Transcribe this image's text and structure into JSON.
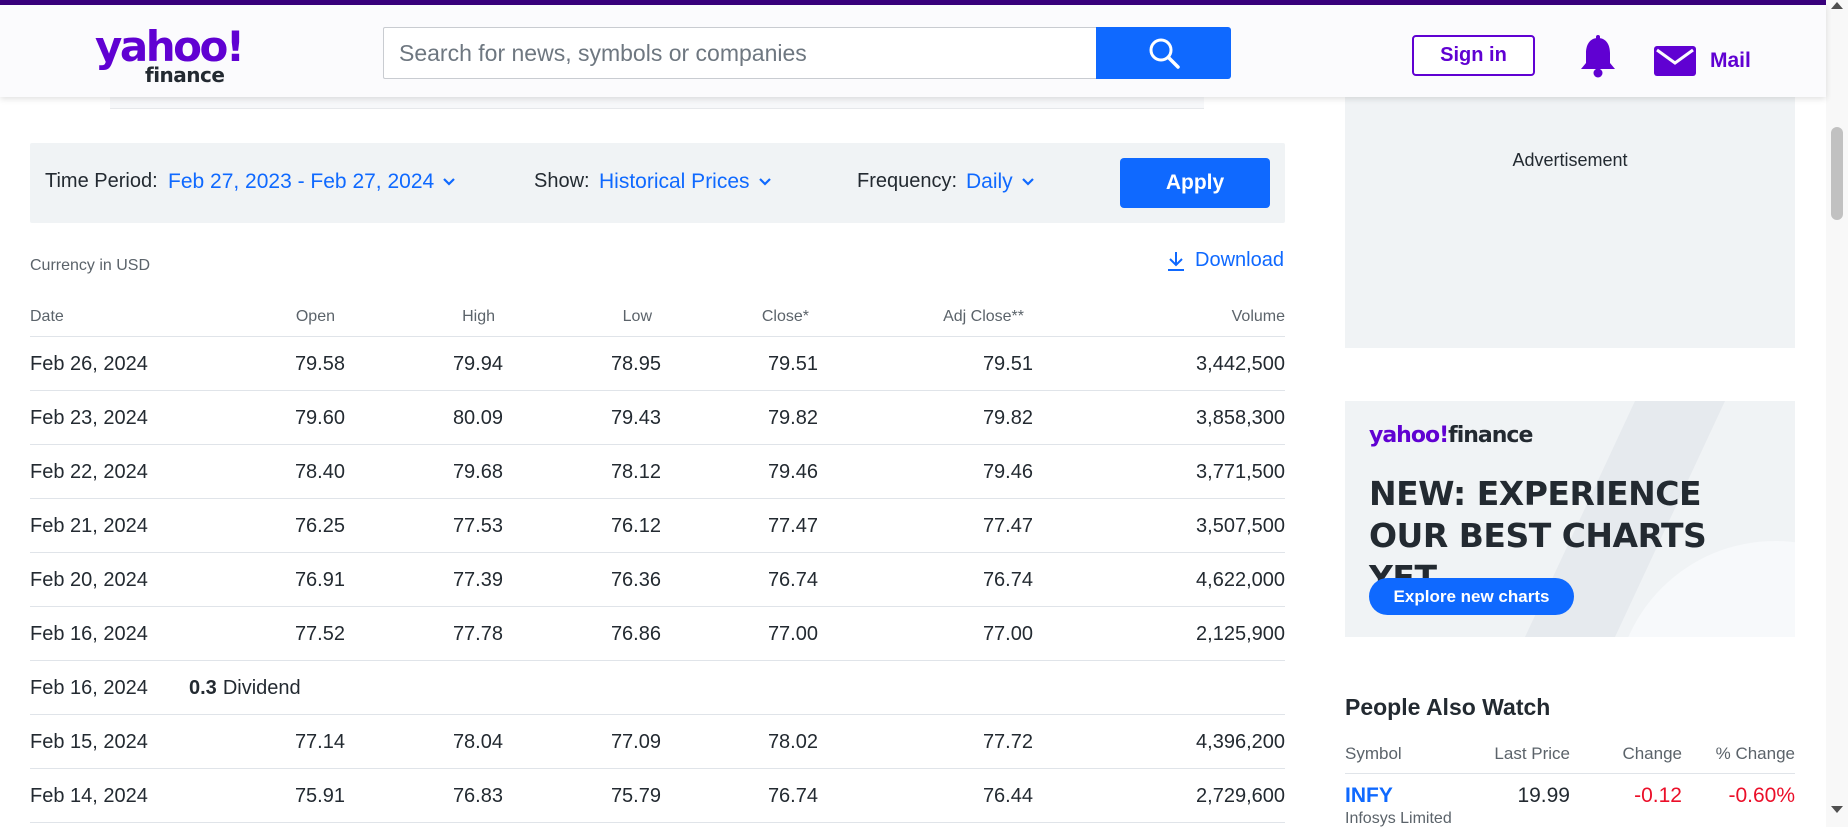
{
  "header": {
    "logo_main": "yahoo!",
    "logo_sub": "finance",
    "search_placeholder": "Search for news, symbols or companies",
    "sign_in_label": "Sign in",
    "mail_label": "Mail",
    "brand_color": "#6001d2",
    "accent_color": "#0f69ff"
  },
  "filters": {
    "time_period_label": "Time Period:",
    "time_period_value": "Feb 27, 2023 - Feb 27, 2024",
    "show_label": "Show:",
    "show_value": "Historical Prices",
    "frequency_label": "Frequency:",
    "frequency_value": "Daily",
    "apply_label": "Apply"
  },
  "currency_note": "Currency in USD",
  "download_label": "Download",
  "table": {
    "columns": [
      "Date",
      "Open",
      "High",
      "Low",
      "Close*",
      "Adj Close**",
      "Volume"
    ],
    "rows": [
      {
        "type": "price",
        "date": "Feb 26, 2024",
        "open": "79.58",
        "high": "79.94",
        "low": "78.95",
        "close": "79.51",
        "adj": "79.51",
        "volume": "3,442,500"
      },
      {
        "type": "price",
        "date": "Feb 23, 2024",
        "open": "79.60",
        "high": "80.09",
        "low": "79.43",
        "close": "79.82",
        "adj": "79.82",
        "volume": "3,858,300"
      },
      {
        "type": "price",
        "date": "Feb 22, 2024",
        "open": "78.40",
        "high": "79.68",
        "low": "78.12",
        "close": "79.46",
        "adj": "79.46",
        "volume": "3,771,500"
      },
      {
        "type": "price",
        "date": "Feb 21, 2024",
        "open": "76.25",
        "high": "77.53",
        "low": "76.12",
        "close": "77.47",
        "adj": "77.47",
        "volume": "3,507,500"
      },
      {
        "type": "price",
        "date": "Feb 20, 2024",
        "open": "76.91",
        "high": "77.39",
        "low": "76.36",
        "close": "76.74",
        "adj": "76.74",
        "volume": "4,622,000"
      },
      {
        "type": "price",
        "date": "Feb 16, 2024",
        "open": "77.52",
        "high": "77.78",
        "low": "76.86",
        "close": "77.00",
        "adj": "77.00",
        "volume": "2,125,900"
      },
      {
        "type": "dividend",
        "date": "Feb 16, 2024",
        "amount": "0.3",
        "label": "Dividend"
      },
      {
        "type": "price",
        "date": "Feb 15, 2024",
        "open": "77.14",
        "high": "78.04",
        "low": "77.09",
        "close": "78.02",
        "adj": "77.72",
        "volume": "4,396,200"
      },
      {
        "type": "price",
        "date": "Feb 14, 2024",
        "open": "75.91",
        "high": "76.83",
        "low": "75.79",
        "close": "76.74",
        "adj": "76.44",
        "volume": "2,729,600"
      }
    ]
  },
  "sidebar": {
    "ad_label": "Advertisement",
    "promo": {
      "logo_y": "yahoo!",
      "logo_f": "finance",
      "headline": "NEW: EXPERIENCE OUR BEST CHARTS YET.",
      "button_label": "Explore new charts"
    },
    "people_also_watch": {
      "title": "People Also Watch",
      "columns": [
        "Symbol",
        "Last Price",
        "Change",
        "% Change"
      ],
      "rows": [
        {
          "symbol": "INFY",
          "name": "Infosys Limited",
          "last_price": "19.99",
          "change": "-0.12",
          "pct_change": "-0.60%"
        }
      ],
      "negative_color": "#eb0f29"
    }
  }
}
